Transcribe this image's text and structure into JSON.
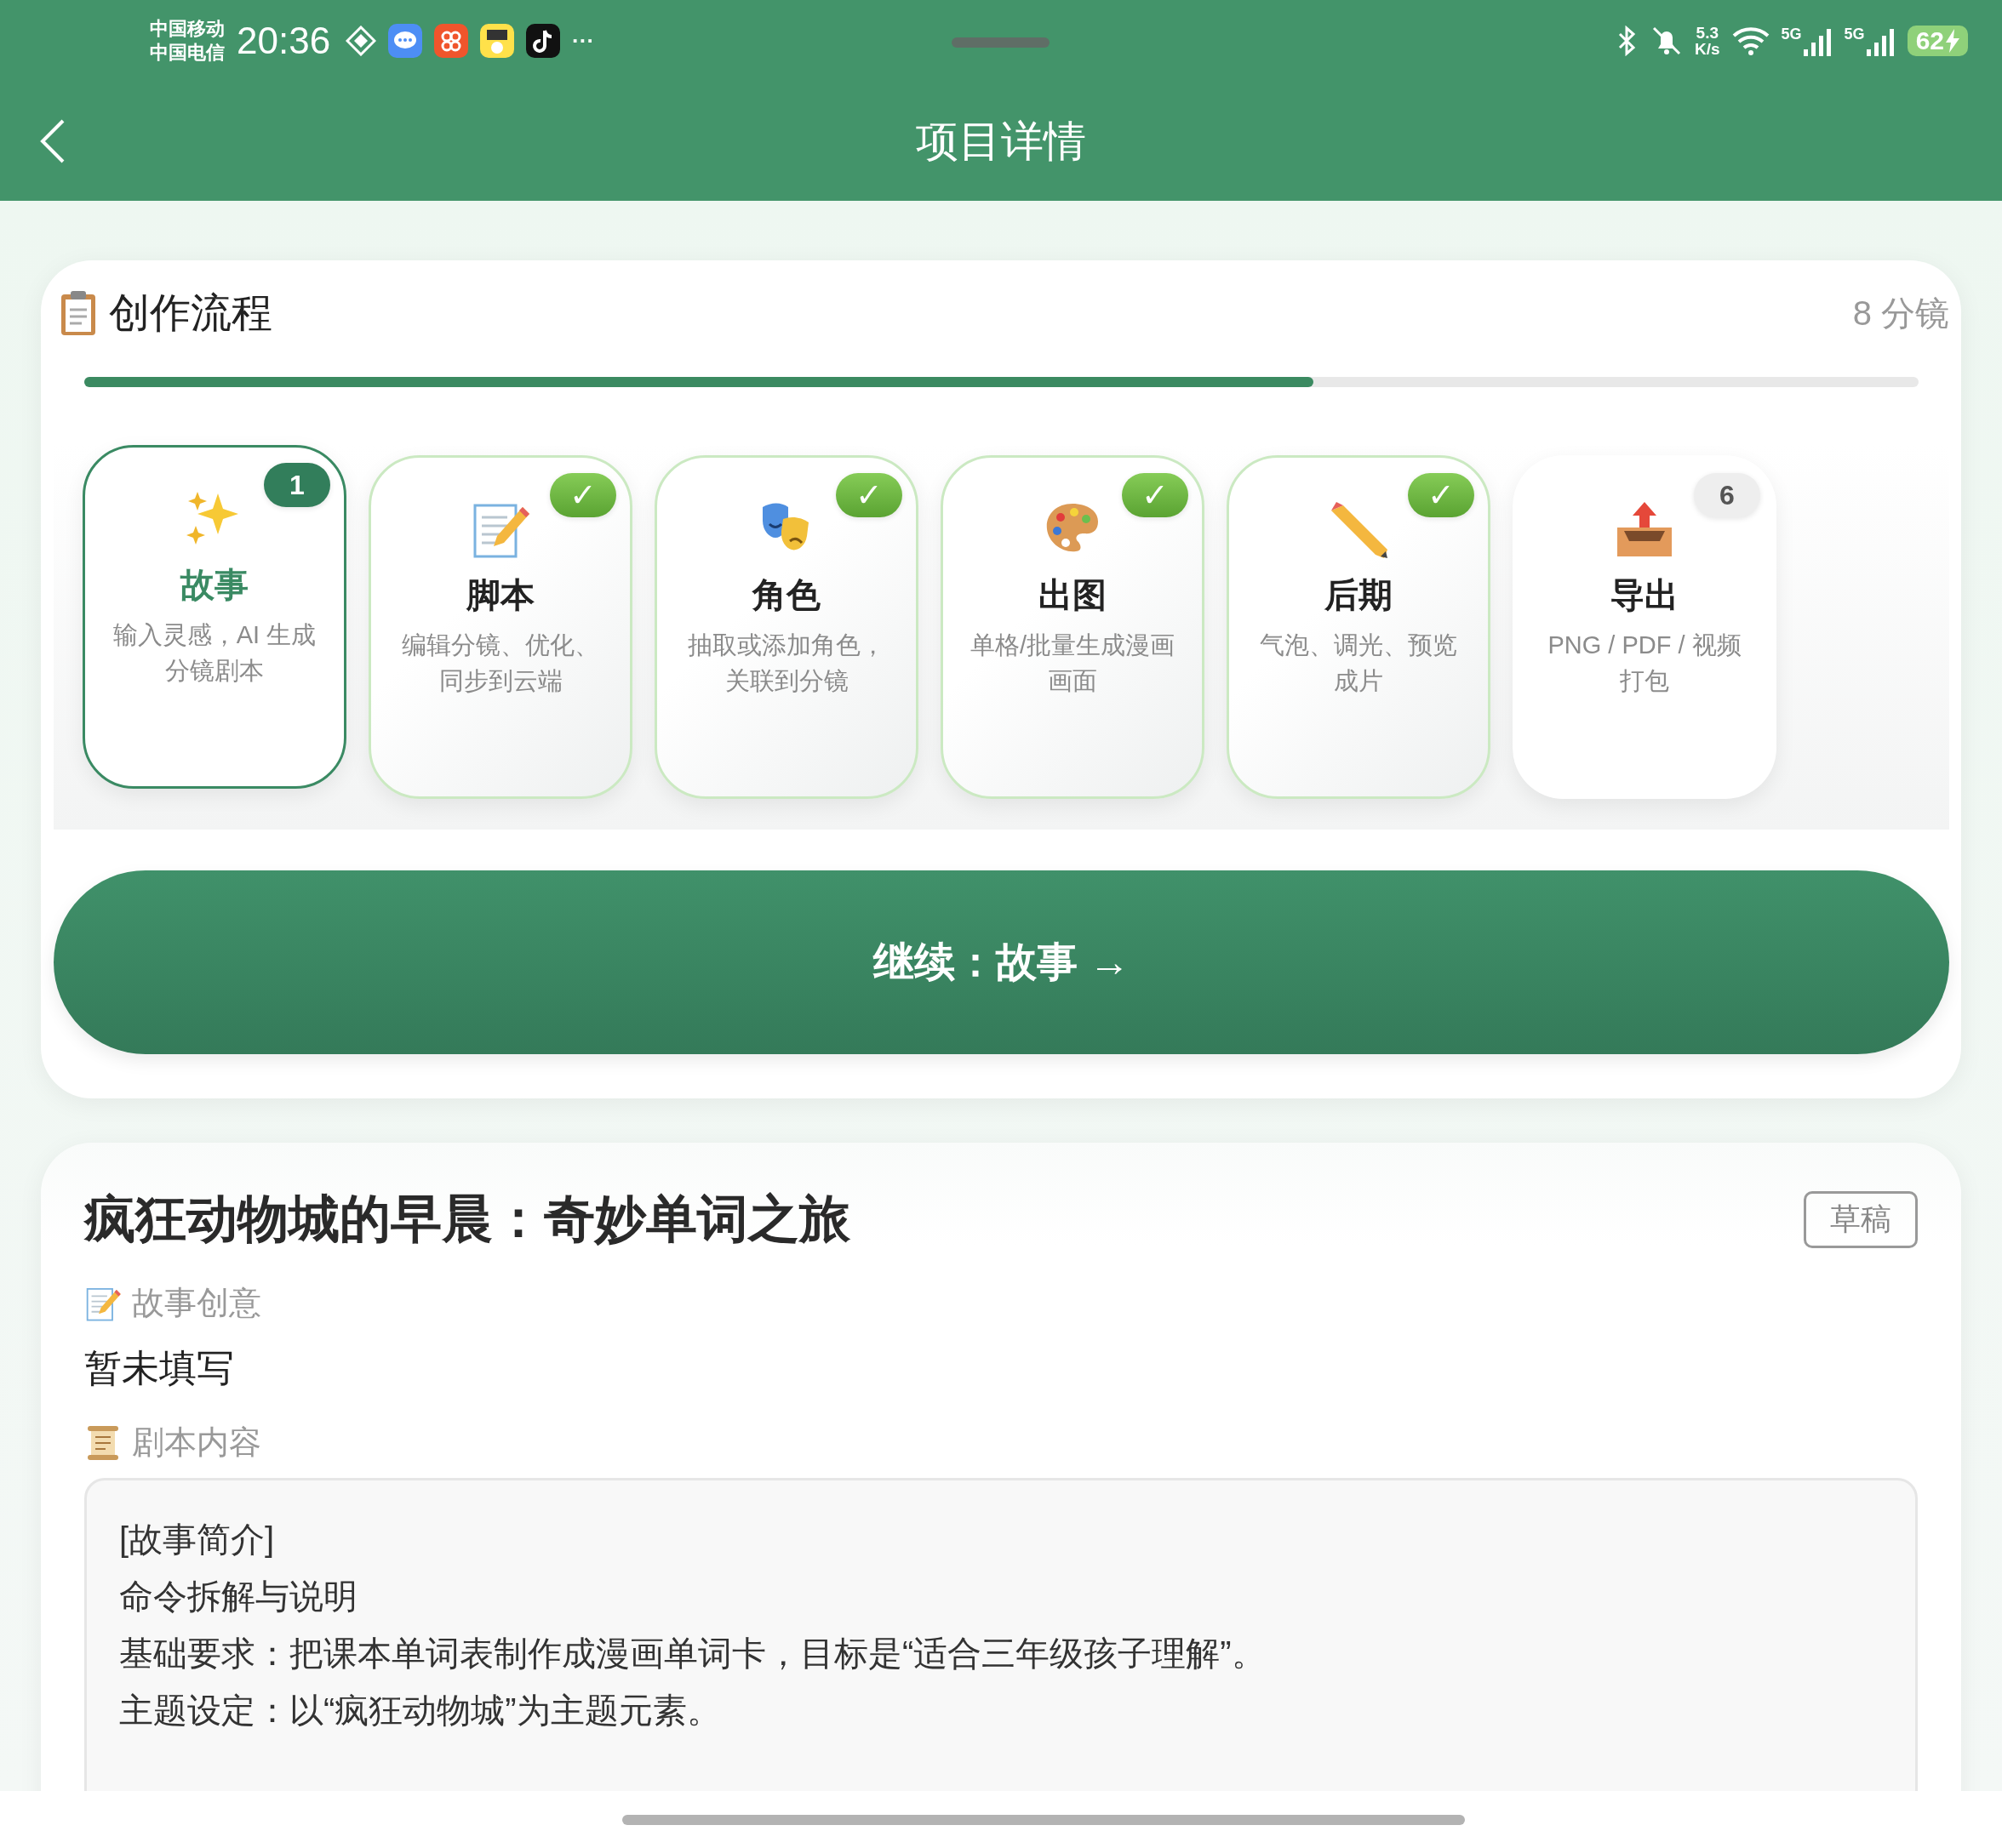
{
  "status_bar": {
    "carriers": [
      "中国移动",
      "中国电信"
    ],
    "time": "20:36",
    "more": "···",
    "net_speed": [
      "5.3",
      "K/s"
    ],
    "networks": [
      "5G",
      "5G"
    ],
    "battery": "62"
  },
  "header": {
    "title": "项目详情"
  },
  "workflow": {
    "title": "创作流程",
    "count": "8 分镜",
    "progress": {
      "level": 0.67
    },
    "steps": [
      {
        "title": "故事",
        "description": "输入灵感，AI 生成分镜剧本",
        "kind": "current",
        "badge": "1"
      },
      {
        "title": "脚本",
        "description": "编辑分镜、优化、同步到云端",
        "kind": "done",
        "badge": "✓"
      },
      {
        "title": "角色",
        "description": "抽取或添加角色，关联到分镜",
        "kind": "done",
        "badge": "✓"
      },
      {
        "title": "出图",
        "description": "单格/批量生成漫画画面",
        "kind": "done",
        "badge": "✓"
      },
      {
        "title": "后期",
        "description": "气泡、调光、预览成片",
        "kind": "done",
        "badge": "✓"
      },
      {
        "title": "导出",
        "description": "PNG / PDF / 视频打包",
        "kind": "pending",
        "badge": "6"
      }
    ],
    "continue_button": "继续：故事 →"
  },
  "project": {
    "title": "疯狂动物城的早晨：奇妙单词之旅",
    "status_badge": "草稿",
    "idea_label": "故事创意",
    "idea": "暂未填写",
    "script_label": "剧本内容",
    "script_lines": [
      "[故事简介]",
      "命令拆解与说明",
      "基础要求：把课本单词表制作成漫画单词卡，目标是“适合三年级孩子理解”。",
      "主题设定：以“疯狂动物城”为主题元素。"
    ]
  }
}
